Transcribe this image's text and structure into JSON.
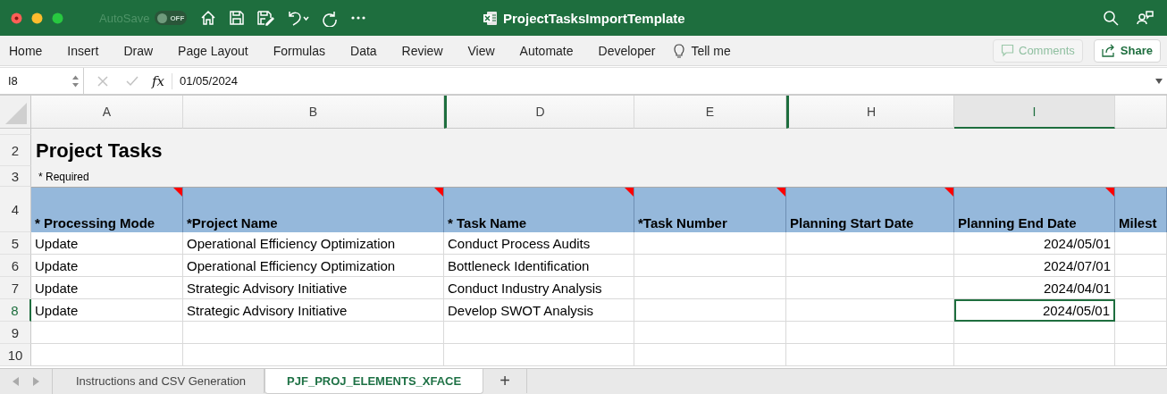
{
  "window": {
    "autosave_label": "AutoSave",
    "autosave_toggle": {
      "label": "OFF",
      "on": false
    },
    "title": "ProjectTasksImportTemplate"
  },
  "ribbon": {
    "tabs": [
      "Home",
      "Insert",
      "Draw",
      "Page Layout",
      "Formulas",
      "Data",
      "Review",
      "View",
      "Automate",
      "Developer"
    ],
    "tell_me": "Tell me",
    "buttons": [
      {
        "kind": "comments",
        "label": "Comments",
        "disabled": true
      },
      {
        "kind": "share",
        "label": "Share",
        "disabled": false
      }
    ]
  },
  "formula_bar": {
    "name_box": "I8",
    "function_label": "fx",
    "formula": "01/05/2024"
  },
  "sheet": {
    "columns": [
      {
        "label": "A",
        "kind": "text",
        "selected": false,
        "after_hidden": false
      },
      {
        "label": "B",
        "kind": "text",
        "selected": false,
        "after_hidden": false
      },
      {
        "label": "D",
        "kind": "text",
        "selected": false,
        "after_hidden": true
      },
      {
        "label": "E",
        "kind": "text",
        "selected": false,
        "after_hidden": false
      },
      {
        "label": "H",
        "kind": "date",
        "selected": false,
        "after_hidden": true
      },
      {
        "label": "I",
        "kind": "date",
        "selected": true,
        "after_hidden": false
      }
    ],
    "title_row": {
      "number": "2",
      "text": "Project Tasks"
    },
    "note_row": {
      "number": "3",
      "text": "* Required"
    },
    "header_row": {
      "number": "4",
      "headers": [
        {
          "text": "* Processing Mode",
          "has_comment": true
        },
        {
          "text": "*Project Name",
          "has_comment": true
        },
        {
          "text": "* Task Name",
          "has_comment": true
        },
        {
          "text": "*Task Number",
          "has_comment": true
        },
        {
          "text": "Planning Start Date",
          "has_comment": true
        },
        {
          "text": "Planning End Date",
          "has_comment": true
        },
        {
          "text": "Milest",
          "has_comment": false
        }
      ]
    },
    "rows": [
      {
        "number": "5",
        "selected": false,
        "processing_mode": "Update",
        "project_name": "Operational Efficiency Optimization",
        "task_name": "Conduct Process Audits",
        "planning_end_date": "2024/05/01"
      },
      {
        "number": "6",
        "selected": false,
        "processing_mode": "Update",
        "project_name": "Operational Efficiency Optimization",
        "task_name": "Bottleneck Identification",
        "planning_end_date": "2024/07/01"
      },
      {
        "number": "7",
        "selected": false,
        "processing_mode": "Update",
        "project_name": "Strategic Advisory Initiative",
        "task_name": "Conduct Industry Analysis",
        "planning_end_date": "2024/04/01"
      },
      {
        "number": "8",
        "selected": true,
        "processing_mode": "Update",
        "project_name": "Strategic Advisory Initiative",
        "task_name": "Develop SWOT Analysis",
        "planning_end_date": "2024/05/01"
      },
      {
        "number": "9",
        "selected": false
      },
      {
        "number": "10",
        "selected": false
      }
    ]
  },
  "sheet_tabs": {
    "tabs": [
      {
        "label": "Instructions and CSV Generation",
        "selected": false
      },
      {
        "label": "PJF_PROJ_ELEMENTS_XFACE",
        "selected": true
      }
    ],
    "add_label": "+"
  }
}
